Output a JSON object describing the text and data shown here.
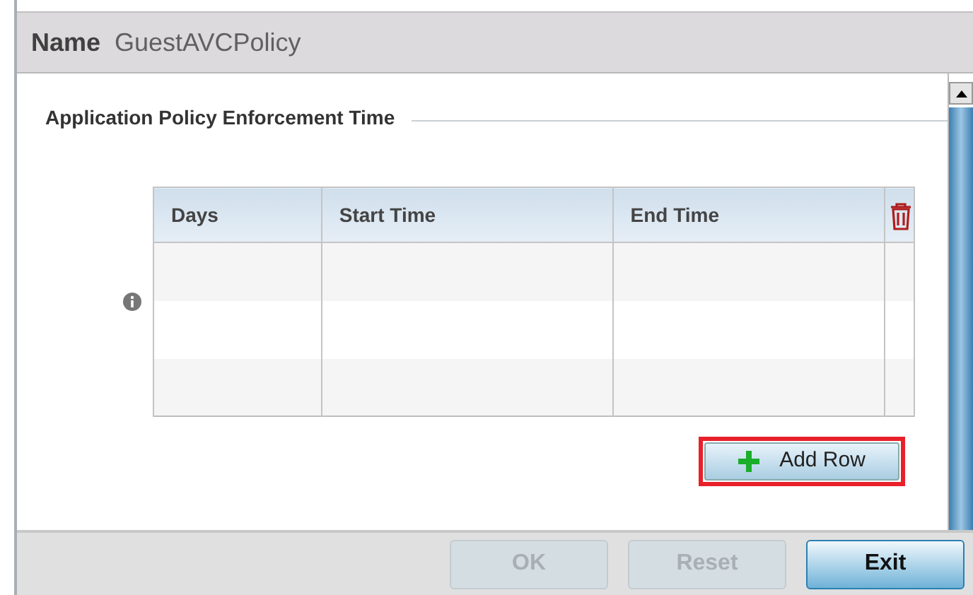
{
  "header": {
    "label": "Name",
    "value": "GuestAVCPolicy"
  },
  "section": {
    "title": "Application Policy Enforcement Time"
  },
  "table": {
    "columns": [
      "Days",
      "Start Time",
      "End Time"
    ]
  },
  "add_row": {
    "label": "Add Row",
    "highlighted": true
  },
  "buttons": [
    {
      "label": "OK",
      "disabled": true
    },
    {
      "label": "Reset",
      "disabled": true
    },
    {
      "label": "Exit",
      "disabled": false,
      "primary": true
    }
  ]
}
